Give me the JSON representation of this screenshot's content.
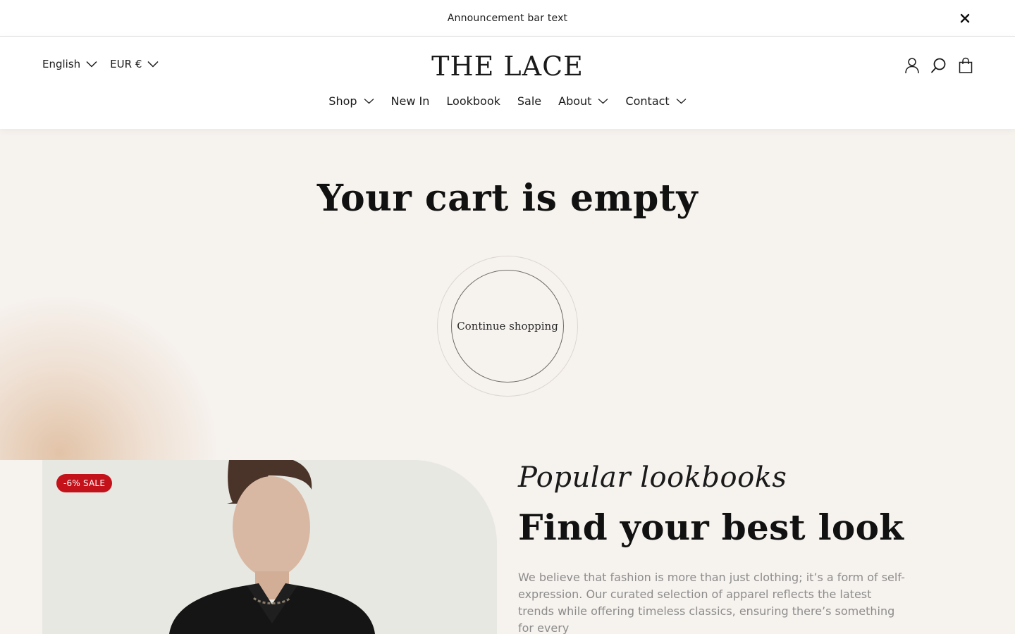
{
  "announcement": {
    "text": "Announcement bar text",
    "close_icon": "close-icon"
  },
  "header": {
    "language": "English",
    "currency": "EUR €",
    "logo": "THE LACE",
    "icons": [
      "account-icon",
      "search-icon",
      "cart-icon"
    ]
  },
  "nav": {
    "items": [
      {
        "label": "Shop",
        "has_dropdown": true
      },
      {
        "label": "New In",
        "has_dropdown": false
      },
      {
        "label": "Lookbook",
        "has_dropdown": false
      },
      {
        "label": "Sale",
        "has_dropdown": false
      },
      {
        "label": "About",
        "has_dropdown": true
      },
      {
        "label": "Contact",
        "has_dropdown": true
      }
    ]
  },
  "cart": {
    "title": "Your cart is empty",
    "continue_label": "Continue shopping"
  },
  "lookbook": {
    "badge": "-6% SALE",
    "script_title": "Popular lookbooks",
    "heading": "Find your best look",
    "body": "We believe that fashion is more than just clothing; it’s a form of self-expression. Our curated selection of apparel reflects the latest trends while offering timeless classics, ensuring there’s something for every"
  },
  "colors": {
    "page_bg": "#f6f2ee",
    "header_bg": "#ffffff",
    "sale_red": "#c4121b",
    "body_text_gray": "#8c8c8c",
    "glow": "#d7aa82"
  }
}
